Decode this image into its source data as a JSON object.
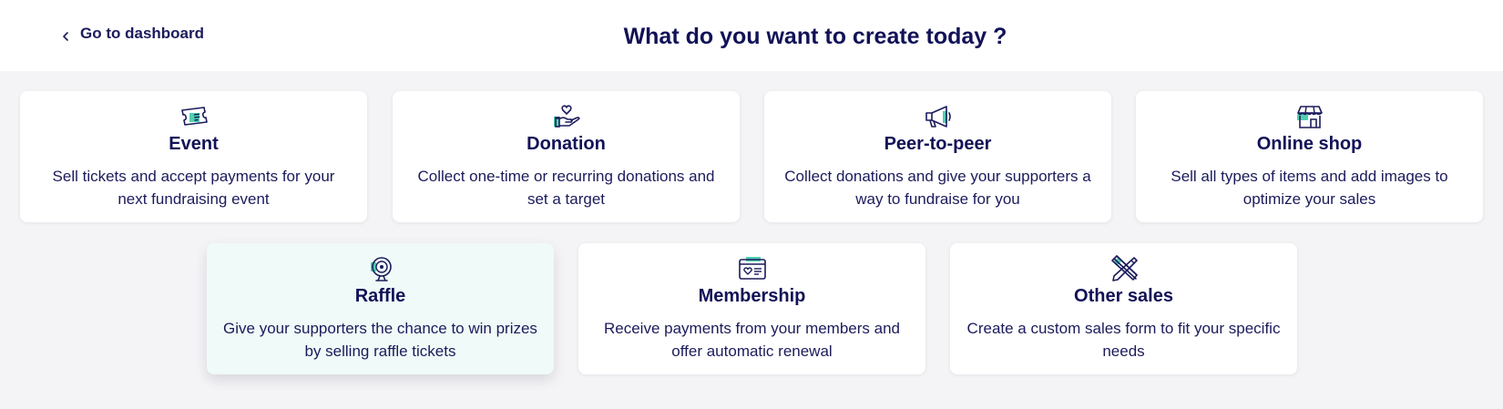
{
  "header": {
    "back_label": "Go to dashboard",
    "title": "What do you want to create today ?"
  },
  "colors": {
    "navy": "#1b1b5c",
    "accent_green": "#4fd1b0",
    "active_card_bg": "#f0faf8",
    "page_bg": "#f4f4f6"
  },
  "cards": [
    {
      "title": "Event",
      "description": "Sell tickets and accept payments for your next fundraising event",
      "icon": "ticket-icon",
      "active": false
    },
    {
      "title": "Donation",
      "description": "Collect one-time or recurring donations and set a target",
      "icon": "heart-hand-icon",
      "active": false
    },
    {
      "title": "Peer-to-peer",
      "description": "Collect donations and give your supporters a way to fundraise for you",
      "icon": "megaphone-icon",
      "active": false
    },
    {
      "title": "Online shop",
      "description": "Sell all types of items and add images to optimize your sales",
      "icon": "storefront-icon",
      "active": false
    },
    {
      "title": "Raffle",
      "description": "Give your supporters the chance to win prizes by selling raffle tickets",
      "icon": "raffle-drum-icon",
      "active": true
    },
    {
      "title": "Membership",
      "description": "Receive payments from your members and offer automatic renewal",
      "icon": "membership-card-icon",
      "active": false
    },
    {
      "title": "Other sales",
      "description": "Create a custom sales form to fit your specific needs",
      "icon": "pencil-ruler-icon",
      "active": false
    }
  ]
}
